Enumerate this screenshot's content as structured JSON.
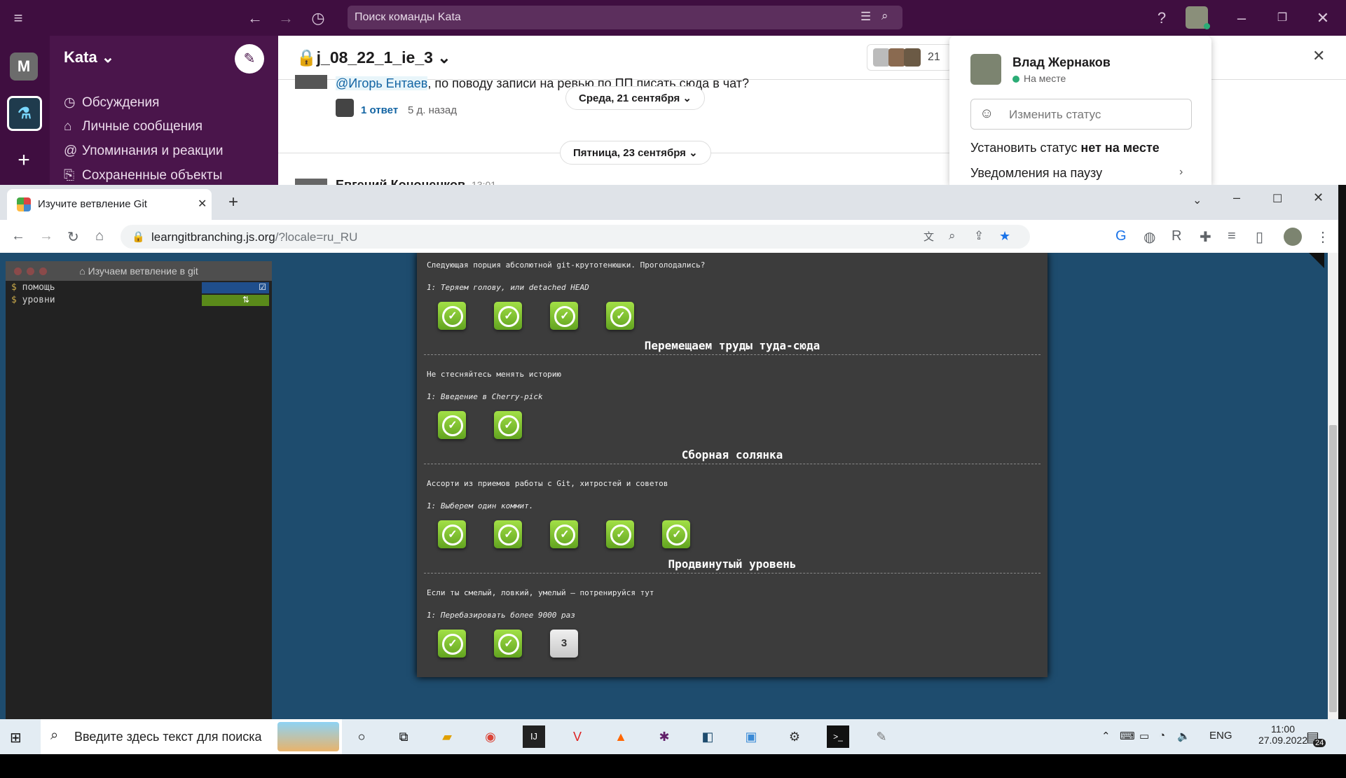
{
  "slack": {
    "search_placeholder": "Поиск команды Kata",
    "workspace_initial": "M",
    "workspace_name": "Kata",
    "sidebar": [
      {
        "icon": "thread-icon",
        "glyph": "◷",
        "label": "Обсуждения"
      },
      {
        "icon": "dm-icon",
        "glyph": "⌂",
        "label": "Личные сообщения"
      },
      {
        "icon": "at-icon",
        "glyph": "@",
        "label": "Упоминания и реакции"
      },
      {
        "icon": "bookmark-icon",
        "glyph": "⎘",
        "label": "Сохраненные объекты"
      }
    ],
    "channel_name": "j_08_22_1_ie_3",
    "member_count": "21",
    "message": {
      "mention": "@Игорь Ентаев",
      "text": ", по поводу записи на ревью по ПП писать сюда в чат?",
      "replies": "1 ответ",
      "reply_time": "5 д. назад"
    },
    "date_pill_1": "Среда, 21 сентября",
    "date_pill_2": "Пятница, 23 сентября",
    "next_author": "Евгений Кононенков",
    "next_time": "13:01",
    "profile": {
      "name": "Влад Жернаков",
      "presence": "На месте",
      "status_placeholder": "Изменить статус",
      "away_prefix": "Установить статус ",
      "away_bold": "нет на месте",
      "pause": "Уведомления на паузу"
    }
  },
  "chrome": {
    "tab_title": "Изучите ветвление Git",
    "url_host": "learngitbranching.js.org",
    "url_path": "/?locale=ru_RU"
  },
  "terminal": {
    "title": "Изучаем ветвление в git",
    "commands": [
      "помощь",
      "уровни"
    ]
  },
  "levels": {
    "top_desc": "Следующая порция абсолютной git-крутотенюшки. Проголодались?",
    "top_sub": "1: Теряем голову, или detached HEAD",
    "top_count": 4,
    "sections": [
      {
        "title": "Перемещаем труды туда-сюда",
        "desc": "Не стесняйтесь менять историю",
        "sub": "1: Введение в Cherry-pick",
        "done": 2,
        "pending": []
      },
      {
        "title": "Сборная солянка",
        "desc": "Ассорти из приемов работы с Git, хитростей и советов",
        "sub": "1: Выберем один коммит.",
        "done": 5,
        "pending": []
      },
      {
        "title": "Продвинутый уровень",
        "desc": "Если ты смелый, ловкий, умелый – потренируйся тут",
        "sub": "1: Перебазировать более 9000 раз",
        "done": 2,
        "pending": [
          "3"
        ]
      }
    ]
  },
  "taskbar": {
    "search_placeholder": "Введите здесь текст для поиска",
    "lang": "ENG",
    "time": "11:00",
    "date": "27.09.2022",
    "notifications": "24"
  }
}
